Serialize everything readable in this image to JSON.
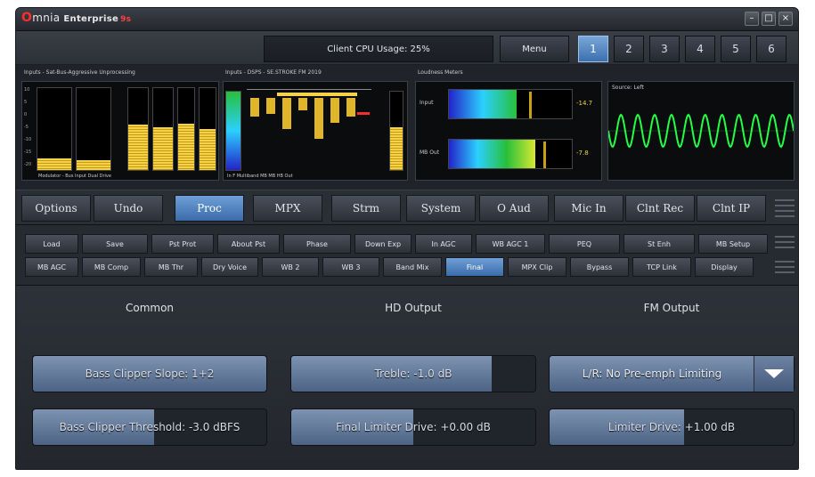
{
  "window": {
    "title_brand_o": "O",
    "title_brand_rest": "mnia",
    "title_edition": "Enterprise",
    "title_version": "9s",
    "controls": [
      "–",
      "□",
      "×"
    ]
  },
  "topbar": {
    "cpu_usage": "Client CPU Usage: 25%",
    "menu_label": "Menu",
    "presets": [
      "1",
      "2",
      "3",
      "4",
      "5",
      "6"
    ],
    "active_preset": "1"
  },
  "meters": {
    "agc_panel_title": "Inputs - Sat-Bus-Aggressive Unprocessing",
    "agc_bottom_labels": "Modulator - Bus   Input  Dual  Drive",
    "agc_scale": [
      "10",
      "5",
      "0",
      "-5",
      "-10",
      "-15",
      "-20"
    ],
    "agc_levels": [
      0.14,
      0.12,
      0.55,
      0.52,
      0.56,
      0.5
    ],
    "mb_panel_title": "Inputs - DSPS - SE.STROKE FM 2019",
    "mb_bottom_labels": "In   F   Multiband   MB  MB   HB   Out",
    "mb_band_levels": [
      0.3,
      0.25,
      0.5,
      0.2,
      0.65,
      0.4,
      0.3
    ],
    "io_panel_title": "Loudness Meters",
    "io_rows": [
      {
        "label": "Input",
        "readout": "-14.7",
        "fill": 0.55
      },
      {
        "label": "MB Out",
        "readout": "-7.8",
        "fill": 0.7
      }
    ],
    "scope_panel_title": "Source: Left",
    "colors": {
      "accent": "#3b6ca9",
      "amber": "#f5d24a",
      "scope": "#22ff44",
      "red": "#ff2e2e"
    }
  },
  "main_tabs": [
    "Options",
    "Undo",
    "Proc",
    "MPX",
    "Strm",
    "System",
    "O Aud",
    "Mic In",
    "Clnt Rec",
    "Clnt IP"
  ],
  "active_main_tab": "Proc",
  "sub_tabs_row1": [
    "Load",
    "Save",
    "Pst Prot",
    "About Pst",
    "Phase",
    "Down Exp",
    "In AGC",
    "WB AGC 1",
    "PEQ",
    "St Enh",
    "MB Setup"
  ],
  "sub_tabs_row2": [
    "MB AGC",
    "MB Comp",
    "MB Thr",
    "Dry Voice",
    "WB 2",
    "WB 3",
    "Band Mix",
    "Final",
    "MPX Clip",
    "Bypass",
    "TCP Link",
    "Display"
  ],
  "active_sub_tab": "Final",
  "content": {
    "col_common": "Common",
    "col_hd": "HD Output",
    "col_fm": "FM Output",
    "bass_slope": {
      "label": "Bass Clipper Slope: 1+2",
      "level": 1.0
    },
    "treble": {
      "label": "Treble: -1.0 dB",
      "level": 0.82
    },
    "lr_dropdown": {
      "label": "L/R: No Pre-emph Limiting"
    },
    "bass_threshold": {
      "label": "Bass Clipper Threshold: -3.0 dBFS",
      "level": 0.52
    },
    "final_drive": {
      "label": "Final Limiter Drive: +0.00 dB",
      "level": 0.5
    },
    "limiter_drive": {
      "label": "Limiter Drive: +1.00 dB",
      "level": 0.55
    }
  }
}
